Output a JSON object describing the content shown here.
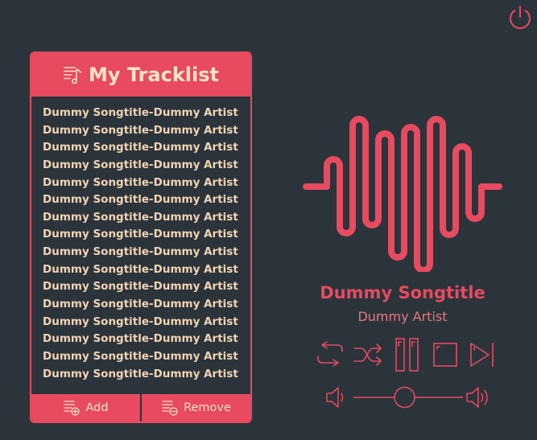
{
  "app": {
    "icons": {
      "power": "power-icon",
      "playlist": "playlist-icon",
      "add": "playlist-add-icon",
      "remove": "playlist-remove-icon",
      "logo": "sound-wave-icon",
      "repeat": "repeat-icon",
      "shuffle": "shuffle-icon",
      "pause": "pause-icon",
      "stop": "stop-icon",
      "next": "skip-next-icon",
      "volume_down": "volume-down-icon",
      "volume_up": "volume-up-icon"
    },
    "colors": {
      "background": "#2b343b",
      "accent": "#e84a5f",
      "header_text": "#ffe3c8",
      "track_text": "#f2d3b3",
      "artist_text": "#e8777e"
    }
  },
  "tracklist": {
    "title": "My Tracklist",
    "items": [
      "Dummy Songtitle-Dummy Artist",
      "Dummy Songtitle-Dummy Artist",
      "Dummy Songtitle-Dummy Artist",
      "Dummy Songtitle-Dummy Artist",
      "Dummy Songtitle-Dummy Artist",
      "Dummy Songtitle-Dummy Artist",
      "Dummy Songtitle-Dummy Artist",
      "Dummy Songtitle-Dummy Artist",
      "Dummy Songtitle-Dummy Artist",
      "Dummy Songtitle-Dummy Artist",
      "Dummy Songtitle-Dummy Artist",
      "Dummy Songtitle-Dummy Artist",
      "Dummy Songtitle-Dummy Artist",
      "Dummy Songtitle-Dummy Artist",
      "Dummy Songtitle-Dummy Artist",
      "Dummy Songtitle-Dummy Artist"
    ],
    "add_label": "Add",
    "remove_label": "Remove"
  },
  "player": {
    "song_title": "Dummy Songtitle",
    "artist": "Dummy Artist",
    "volume_level": 0.46
  }
}
